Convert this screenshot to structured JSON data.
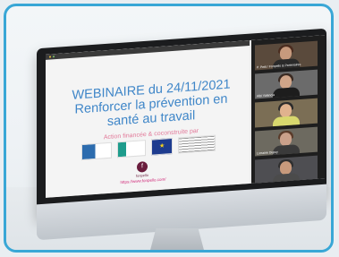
{
  "slide": {
    "title": "WEBINAIRE du 24/11/2021\nRenforcer la prévention en\nsanté au travail",
    "subtitle": "Action financée & coconstruite par",
    "url": "https://www.fonpello.com/"
  },
  "gallery": [
    {
      "name": "P. Petit / Fonpello & Partenaires"
    },
    {
      "name": "Albi Valencia"
    },
    {
      "name": ""
    },
    {
      "name": "Lorraine Dupuy"
    },
    {
      "name": ""
    }
  ],
  "brand": {
    "initial": "f",
    "name": "fonpello"
  },
  "colors": {
    "frame": "#39a7d6",
    "title": "#3f86c8",
    "subtitle": "#e27a9a",
    "brand": "#6a1d3d",
    "url": "#d12a7a"
  }
}
